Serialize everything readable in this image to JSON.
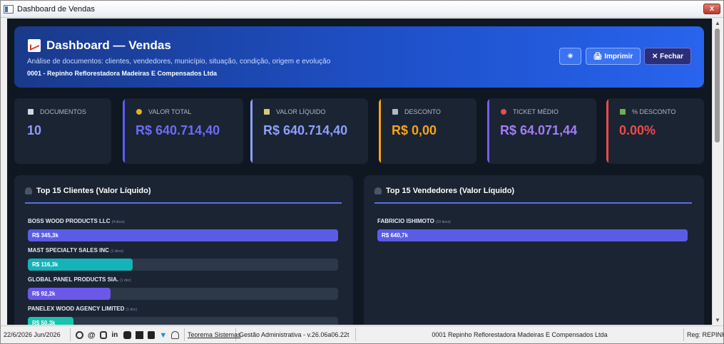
{
  "window": {
    "title": "Dashboard de Vendas",
    "close_glyph": "x"
  },
  "header": {
    "title": "Dashboard — Vendas",
    "title_icon": "chart-emoji-icon",
    "subtitle": "Análise de documentos: clientes, vendedores, município, situação, condição, origem e evolução",
    "company": "0001 - Repinho Reflorestadora Madeiras E Compensados Ltda",
    "buttons": {
      "theme": "☀",
      "print": "🖨 Imprimir",
      "close": "✕ Fechar"
    }
  },
  "kpis": [
    {
      "label": "DOCUMENTOS",
      "value": "10",
      "icon": "document-icon",
      "color": "#8f9bff",
      "accent": ""
    },
    {
      "label": "VALOR TOTAL",
      "value": "R$ 640.714,40",
      "icon": "money-bag-icon",
      "color": "#6b6cf5",
      "accent": "#5b5ef0"
    },
    {
      "label": "VALOR LÍQUIDO",
      "value": "R$ 640.714,40",
      "icon": "cash-icon",
      "color": "#8e9fff",
      "accent": "#8e9fff"
    },
    {
      "label": "DESCONTO",
      "value": "R$ 0,00",
      "icon": "tag-icon",
      "color": "#f6a31a",
      "accent": "#f6a31a"
    },
    {
      "label": "TICKET MÉDIO",
      "value": "R$ 64.071,44",
      "icon": "target-icon",
      "color": "#a47cf7",
      "accent": "#7c5cf0"
    },
    {
      "label": "% DESCONTO",
      "value": "0.00%",
      "icon": "bar-chart-icon",
      "color": "#ef4949",
      "accent": "#ef4949"
    }
  ],
  "clientes": {
    "title": "Top 15 Clientes (Valor Líquido)",
    "items": [
      {
        "name": "BOSS WOOD PRODUCTS LLC",
        "docs": "(4 docs)",
        "value_label": "R$ 345,3k",
        "fraction": 1.0,
        "color": "#5b5ce6"
      },
      {
        "name": "MAST SPECIALTY SALES INC",
        "docs": "(1 docs)",
        "value_label": "R$ 116,3k",
        "fraction": 0.337,
        "color": "#15b3b8"
      },
      {
        "name": "GLOBAL PANEL PRODUCTS SIA.",
        "docs": "(1 doc)",
        "value_label": "R$ 92,2k",
        "fraction": 0.267,
        "color": "#6a58e8"
      },
      {
        "name": "PANELEX WOOD AGENCY LIMITED",
        "docs": "(1 doc)",
        "value_label": "R$ 50,3k",
        "fraction": 0.146,
        "color": "#19c3b0"
      }
    ]
  },
  "vendedores": {
    "title": "Top 15 Vendedores (Valor Líquido)",
    "items": [
      {
        "name": "FABRICIO ISHIMOTO",
        "docs": "(10 docs)",
        "value_label": "R$ 640,7k",
        "fraction": 1.0,
        "color": "#5b5ce6"
      }
    ]
  },
  "statusbar": {
    "date": "22/6/2026 Jun/2026",
    "brand": "Teorema Sistemas",
    "system": "Gestão Administrativa - v.26.06a06.22t",
    "company": "0001 Repinho Reflorestadora Madeiras E Compensados Ltda",
    "reg": "Reg: REPINH"
  }
}
